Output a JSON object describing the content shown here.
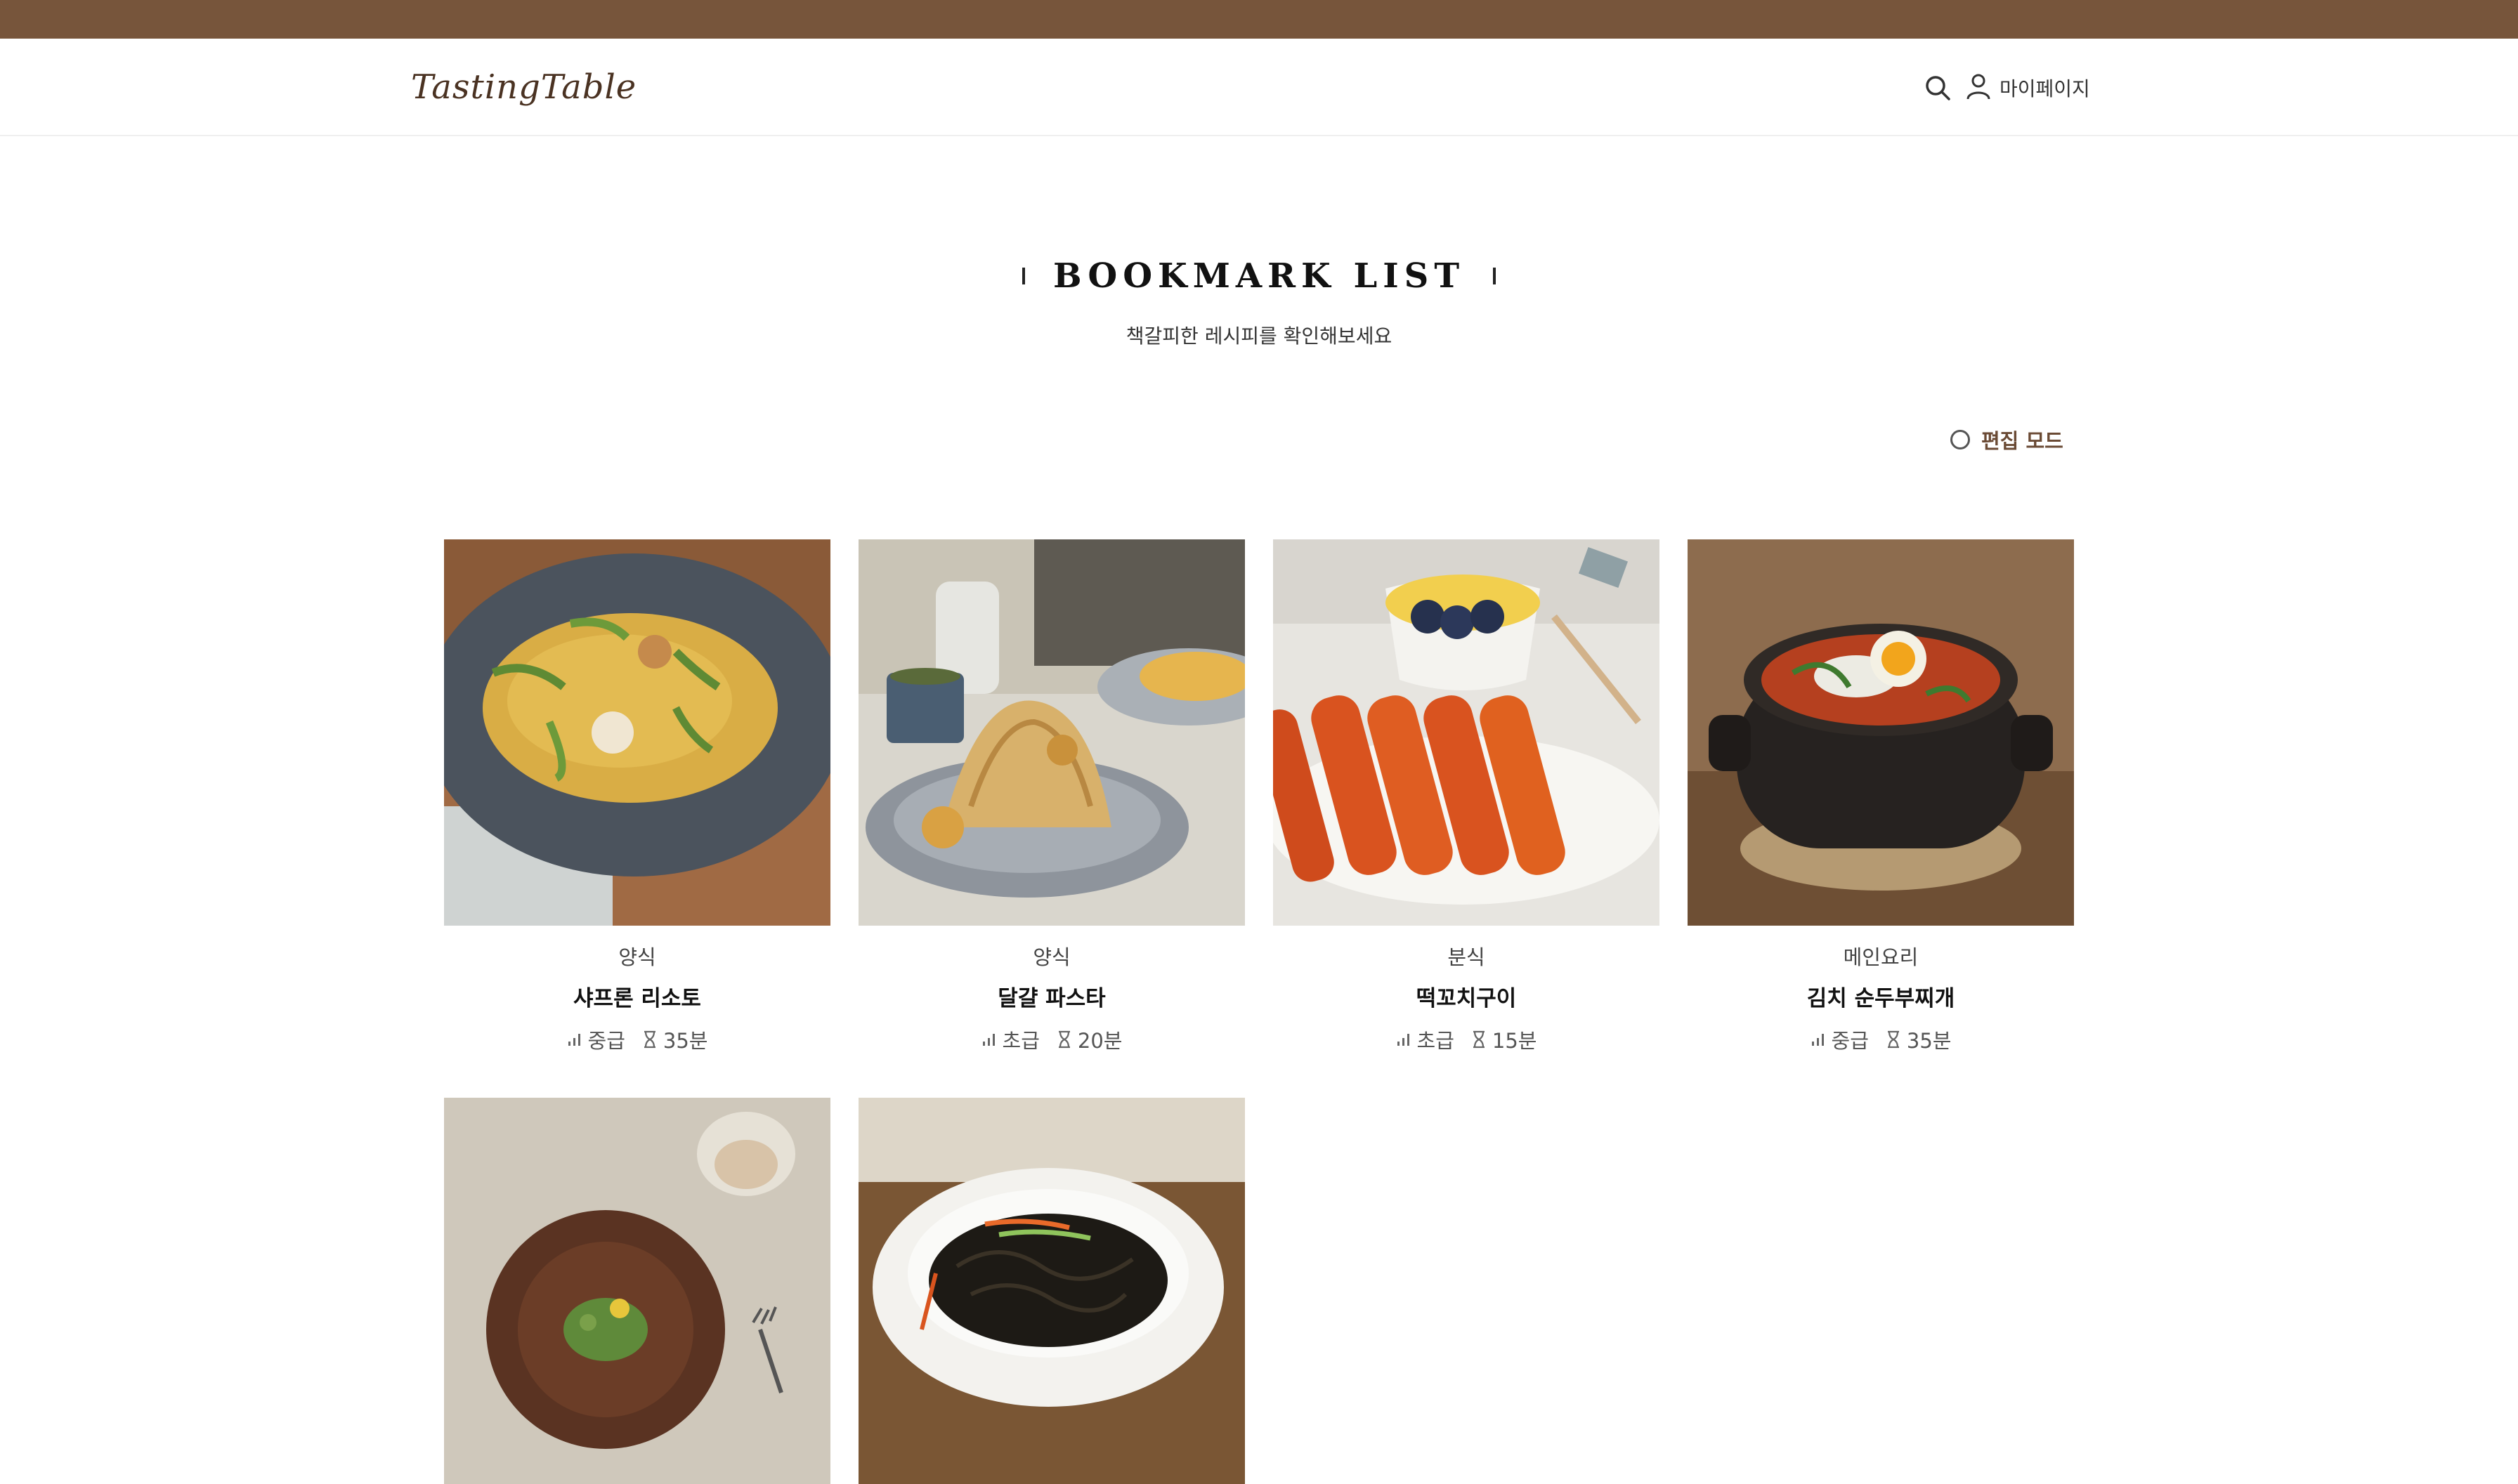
{
  "brand": {
    "logo": "TastingTable"
  },
  "header": {
    "search_icon": "search-icon",
    "user_icon": "user-icon",
    "mypage_label": "마이페이지"
  },
  "page": {
    "title": "BOOKMARK LIST",
    "subtitle": "책갈피한 레시피를 확인해보세요",
    "edit_mode_label": "편집 모드"
  },
  "colors": {
    "top_bar": "#77553b",
    "accent": "#6a4a34"
  },
  "recipes": [
    {
      "category": "양식",
      "name": "샤프론 리소토",
      "level": "중급",
      "time": "35분"
    },
    {
      "category": "양식",
      "name": "달걀 파스타",
      "level": "초급",
      "time": "20분"
    },
    {
      "category": "분식",
      "name": "떡꼬치구이",
      "level": "초급",
      "time": "15분"
    },
    {
      "category": "메인요리",
      "name": "김치 순두부찌개",
      "level": "중급",
      "time": "35분"
    },
    {
      "category": "",
      "name": "",
      "level": "",
      "time": ""
    },
    {
      "category": "",
      "name": "",
      "level": "",
      "time": ""
    }
  ]
}
